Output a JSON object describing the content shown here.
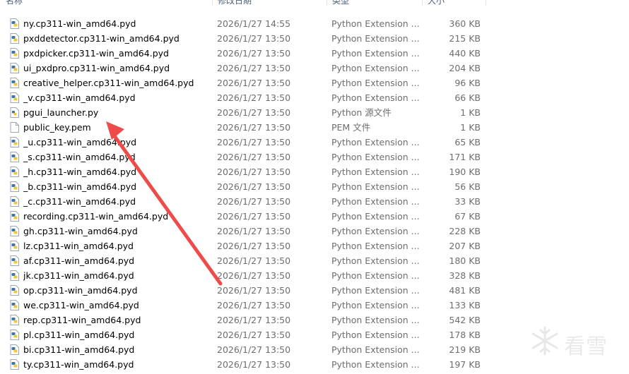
{
  "columns": {
    "name": "名称",
    "date": "修改日期",
    "type": "类型",
    "size": "大小"
  },
  "files": [
    {
      "name": "ny.cp311-win_amd64.pyd",
      "date": "2026/1/27 14:55",
      "type": "Python Extension ...",
      "size": "360 KB",
      "icon": "python-extension-icon"
    },
    {
      "name": "pxddetector.cp311-win_amd64.pyd",
      "date": "2026/1/27 13:50",
      "type": "Python Extension ...",
      "size": "215 KB",
      "icon": "python-extension-icon"
    },
    {
      "name": "pxdpicker.cp311-win_amd64.pyd",
      "date": "2026/1/27 13:50",
      "type": "Python Extension ...",
      "size": "440 KB",
      "icon": "python-extension-icon"
    },
    {
      "name": "ui_pxdpro.cp311-win_amd64.pyd",
      "date": "2026/1/27 13:50",
      "type": "Python Extension ...",
      "size": "204 KB",
      "icon": "python-extension-icon"
    },
    {
      "name": "creative_helper.cp311-win_amd64.pyd",
      "date": "2026/1/27 13:50",
      "type": "Python Extension ...",
      "size": "96 KB",
      "icon": "python-extension-icon"
    },
    {
      "name": "_v.cp311-win_amd64.pyd",
      "date": "2026/1/27 13:50",
      "type": "Python Extension ...",
      "size": "66 KB",
      "icon": "python-extension-icon"
    },
    {
      "name": "pgui_launcher.py",
      "date": "2026/1/27 13:50",
      "type": "Python 源文件",
      "size": "1 KB",
      "icon": "python-source-icon"
    },
    {
      "name": "public_key.pem",
      "date": "2026/1/27 13:50",
      "type": "PEM 文件",
      "size": "1 KB",
      "icon": "blank-file-icon"
    },
    {
      "name": "_u.cp311-win_amd64.pyd",
      "date": "2026/1/27 13:50",
      "type": "Python Extension ...",
      "size": "65 KB",
      "icon": "python-extension-icon"
    },
    {
      "name": "_s.cp311-win_amd64.pyd",
      "date": "2026/1/27 13:50",
      "type": "Python Extension ...",
      "size": "171 KB",
      "icon": "python-extension-icon"
    },
    {
      "name": "_h.cp311-win_amd64.pyd",
      "date": "2026/1/27 13:50",
      "type": "Python Extension ...",
      "size": "190 KB",
      "icon": "python-extension-icon"
    },
    {
      "name": "_b.cp311-win_amd64.pyd",
      "date": "2026/1/27 13:50",
      "type": "Python Extension ...",
      "size": "56 KB",
      "icon": "python-extension-icon"
    },
    {
      "name": "_c.cp311-win_amd64.pyd",
      "date": "2026/1/27 13:50",
      "type": "Python Extension ...",
      "size": "33 KB",
      "icon": "python-extension-icon"
    },
    {
      "name": "recording.cp311-win_amd64.pyd",
      "date": "2026/1/27 13:50",
      "type": "Python Extension ...",
      "size": "67 KB",
      "icon": "python-extension-icon"
    },
    {
      "name": "gh.cp311-win_amd64.pyd",
      "date": "2026/1/27 13:50",
      "type": "Python Extension ...",
      "size": "228 KB",
      "icon": "python-extension-icon"
    },
    {
      "name": "lz.cp311-win_amd64.pyd",
      "date": "2026/1/27 13:50",
      "type": "Python Extension ...",
      "size": "207 KB",
      "icon": "python-extension-icon"
    },
    {
      "name": "af.cp311-win_amd64.pyd",
      "date": "2026/1/27 13:50",
      "type": "Python Extension ...",
      "size": "180 KB",
      "icon": "python-extension-icon"
    },
    {
      "name": "jk.cp311-win_amd64.pyd",
      "date": "2026/1/27 13:50",
      "type": "Python Extension ...",
      "size": "328 KB",
      "icon": "python-extension-icon"
    },
    {
      "name": "op.cp311-win_amd64.pyd",
      "date": "2026/1/27 13:50",
      "type": "Python Extension ...",
      "size": "481 KB",
      "icon": "python-extension-icon"
    },
    {
      "name": "we.cp311-win_amd64.pyd",
      "date": "2026/1/27 13:50",
      "type": "Python Extension ...",
      "size": "133 KB",
      "icon": "python-extension-icon"
    },
    {
      "name": "rep.cp311-win_amd64.pyd",
      "date": "2026/1/27 13:50",
      "type": "Python Extension ...",
      "size": "542 KB",
      "icon": "python-extension-icon"
    },
    {
      "name": "pl.cp311-win_amd64.pyd",
      "date": "2026/1/27 13:50",
      "type": "Python Extension ...",
      "size": "178 KB",
      "icon": "python-extension-icon"
    },
    {
      "name": "bi.cp311-win_amd64.pyd",
      "date": "2026/1/27 13:50",
      "type": "Python Extension ...",
      "size": "219 KB",
      "icon": "python-extension-icon"
    },
    {
      "name": "ty.cp311-win_amd64.pyd",
      "date": "2026/1/27 13:50",
      "type": "Python Extension ...",
      "size": "197 KB",
      "icon": "python-extension-icon"
    }
  ],
  "annotation": {
    "arrow_color": "#ef4b4b",
    "arrow_target": "pgui_launcher.py"
  },
  "watermark": {
    "text": "看雪"
  },
  "colors": {
    "header_text": "#4c607a",
    "secondary_text": "#6d6d6d",
    "python_blue": "#3b74ad",
    "python_yellow": "#f2c63a"
  }
}
